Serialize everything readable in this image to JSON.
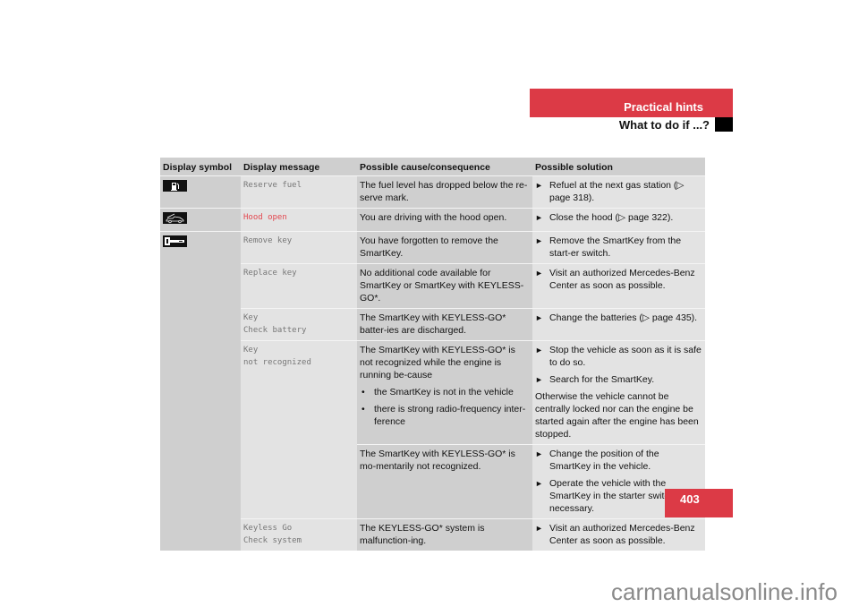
{
  "header": {
    "section": "Practical hints",
    "subsection": "What to do if ...?",
    "page_number": "403"
  },
  "watermark": "carmanualsonline.info",
  "table": {
    "columns": [
      "Display symbol",
      "Display message",
      "Possible cause/consequence",
      "Possible solution"
    ],
    "rows": [
      {
        "symbol": "fuel-pump-icon",
        "message": [
          "Reserve fuel"
        ],
        "cause": "The fuel level has dropped below the re-serve mark.",
        "solutions": [
          "Refuel at the next gas station (▷ page 318)."
        ]
      },
      {
        "symbol": "hood-open-icon",
        "message": [
          "Hood open"
        ],
        "message_color": "#e3474f",
        "cause": "You are driving with the hood open.",
        "solutions": [
          "Close the hood (▷ page 322)."
        ]
      },
      {
        "symbol": "key-icon",
        "message": [
          "Remove key"
        ],
        "cause": "You have forgotten to remove the SmartKey.",
        "solutions": [
          "Remove the SmartKey from the start-er switch."
        ]
      },
      {
        "message": [
          "Replace key"
        ],
        "cause": "No additional code available for SmartKey or SmartKey with KEYLESS-GO*.",
        "solutions": [
          "Visit an authorized Mercedes-Benz Center as soon as possible."
        ]
      },
      {
        "message": [
          "Key",
          "Check battery"
        ],
        "cause": "The SmartKey with KEYLESS-GO* batter-ies are discharged.",
        "solutions": [
          "Change the batteries (▷ page 435)."
        ]
      },
      {
        "message": [
          "Key",
          "not recognized"
        ],
        "cause": "The SmartKey with KEYLESS-GO* is not recognized while the engine is running be-cause",
        "cause_bullets": [
          "the SmartKey is not in the vehicle",
          "there is strong radio-frequency inter-ference"
        ],
        "solutions": [
          "Stop the vehicle as soon as it is safe to do so.",
          "Search for the SmartKey."
        ],
        "note": "Otherwise the vehicle cannot be centrally locked nor can the engine be started again after the engine has been stopped."
      },
      {
        "cause": "The SmartKey with KEYLESS-GO* is mo-mentarily not recognized.",
        "solutions": [
          "Change the position of the SmartKey in the vehicle.",
          "Operate the vehicle with the SmartKey in the starter switch if necessary."
        ]
      },
      {
        "message": [
          "Keyless Go",
          "Check system"
        ],
        "cause": "The KEYLESS-GO* system is malfunction-ing.",
        "solutions": [
          "Visit an authorized Mercedes-Benz Center as soon as possible."
        ]
      }
    ]
  },
  "colors": {
    "accent_red": "#dc3a46",
    "header_gray": "#cfcfcf",
    "cell_light": "#e3e3e3"
  }
}
